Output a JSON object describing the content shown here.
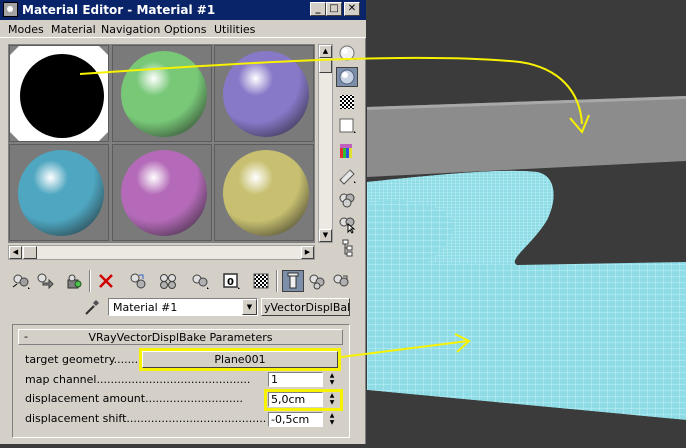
{
  "window": {
    "title": "Material Editor - Material #1",
    "min_glyph": "_",
    "max_glyph": "□",
    "close_glyph": "✕"
  },
  "menu": [
    "Modes",
    "Material",
    "Navigation",
    "Options",
    "Utilities"
  ],
  "slots": [
    {
      "name": "slot-1",
      "color": "#000000",
      "active": true
    },
    {
      "name": "slot-2",
      "color": "#78c878"
    },
    {
      "name": "slot-3",
      "color": "#8878c8"
    },
    {
      "name": "slot-4",
      "color": "#4ea6c0"
    },
    {
      "name": "slot-5",
      "color": "#b46ab8"
    },
    {
      "name": "slot-6",
      "color": "#c8c070"
    }
  ],
  "side_tools": [
    "sample-type-icon",
    "backlight-icon",
    "background-icon",
    "uv-tiling-icon",
    "video-color-check-icon",
    "make-preview-icon",
    "options-icon",
    "select-by-material-icon",
    "material-map-navigator-icon"
  ],
  "bottom_tools": [
    "get-material-icon",
    "put-to-scene-icon",
    "assign-to-selection-icon",
    "reset-map-icon",
    "make-unique-icon",
    "put-to-library-icon",
    "material-id-channel-icon",
    "show-map-icon",
    "show-end-result-icon",
    "go-to-parent-icon",
    "go-forward-icon"
  ],
  "material": {
    "name": "Material #1",
    "type": "yVectorDisplBake"
  },
  "rollout": {
    "minus": "-",
    "title": "VRayVectorDisplBake Parameters"
  },
  "params": {
    "target_geometry_label": "target geometry..........",
    "target_geometry_value": "Plane001",
    "map_channel_label": "map channel............................................",
    "map_channel_value": "1",
    "displacement_amount_label": "displacement amount............................",
    "displacement_amount_value": "5,0cm",
    "displacement_shift_label": "displacement shift........................................",
    "displacement_shift_value": "-0,5cm"
  },
  "colors": {
    "highlight": "#f7f200",
    "mesh": "#9fe8f0",
    "titlebar": "#0a246a"
  }
}
